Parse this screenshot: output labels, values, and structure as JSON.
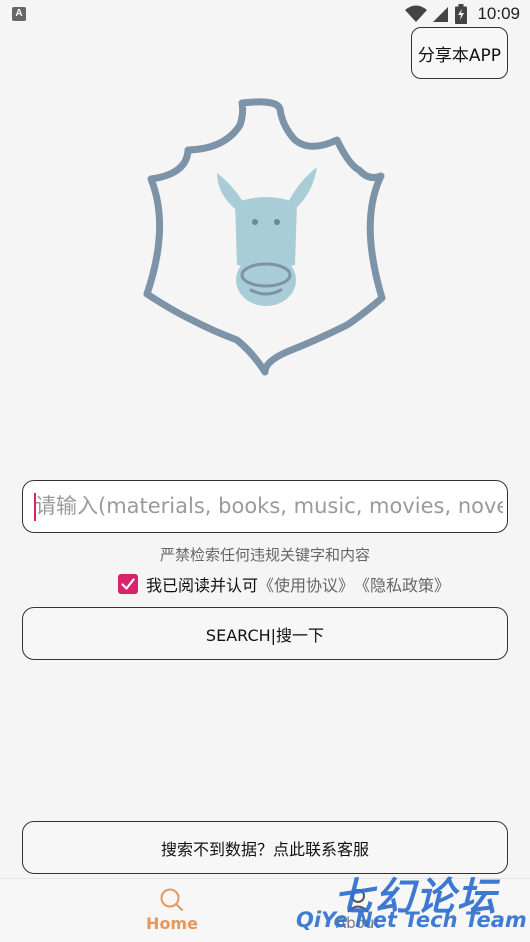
{
  "status_bar": {
    "badge": "A",
    "time": "10:09",
    "icons": [
      "wifi-icon",
      "signal-icon",
      "battery-icon"
    ]
  },
  "header": {
    "share_label": "分享本APP"
  },
  "search": {
    "placeholder": "请输入(materials, books, music, movies, novels...)",
    "value": "",
    "warning": "严禁检索任何违规关键字和内容",
    "agree_text": "我已阅读并认可",
    "terms_link": "《使用协议》",
    "privacy_link": "《隐私政策》",
    "agreed": true,
    "button_label": "SEARCH|搜一下"
  },
  "contact": {
    "label": "搜索不到数据？点此联系客服"
  },
  "bottom_nav": {
    "items": [
      {
        "label": "Home",
        "icon": "search-icon",
        "active": true
      },
      {
        "label": "About",
        "icon": "person-icon",
        "active": false
      }
    ]
  },
  "watermark": {
    "cn": "七幻论坛",
    "en": "QiYe Net Tech Team"
  },
  "colors": {
    "accent": "#d6246e",
    "nav_active": "#e8965a",
    "logo_outline": "#7d93a8",
    "logo_donkey": "#a9cdd6",
    "watermark": "#2e6fd0"
  }
}
